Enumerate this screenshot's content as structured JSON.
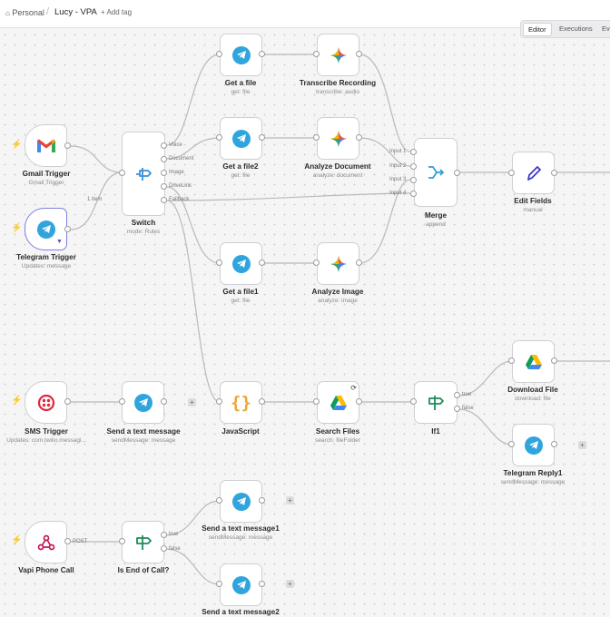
{
  "header": {
    "project": "Personal",
    "workflow_name": "Lucy - VPA",
    "add_tag": "+ Add tag",
    "tabs": [
      "Editor",
      "Executions",
      "Eva"
    ]
  },
  "colors": {
    "telegram": "#30a5dd",
    "gmail_red": "#ea4335",
    "twilio_red": "#e0263e",
    "switch_blue": "#3a8fd8",
    "if_green": "#1f8a5a",
    "edit_purple": "#3f37c9",
    "trigger_bolt": "#f07b5b",
    "selected_border": "#7b7fe0"
  },
  "nodes": {
    "gmail_trigger": {
      "title": "Gmail Trigger",
      "subtitle": "Gmail Trigger",
      "icon": "gmail-icon"
    },
    "telegram_trigger": {
      "title": "Telegram Trigger",
      "subtitle": "Updates: message",
      "icon": "telegram-icon"
    },
    "switch": {
      "title": "Switch",
      "subtitle": "mode: Rules",
      "icon": "switch-icon",
      "outputs": [
        "Voice",
        "Document",
        "Image",
        "DriveLink",
        "Fallback"
      ]
    },
    "get_file": {
      "title": "Get a file",
      "subtitle": "get: file"
    },
    "get_file2": {
      "title": "Get a file2",
      "subtitle": "get: file"
    },
    "get_file1": {
      "title": "Get a file1",
      "subtitle": "get: file"
    },
    "transcribe": {
      "title": "Transcribe Recording",
      "subtitle": "transcribe: audio"
    },
    "analyze_document": {
      "title": "Analyze Document",
      "subtitle": "analyze: document"
    },
    "analyze_image": {
      "title": "Analyze Image",
      "subtitle": "analyze: image"
    },
    "merge": {
      "title": "Merge",
      "subtitle": "append",
      "inputs": [
        "Input 1",
        "Input 2",
        "Input 3",
        "Input 4"
      ]
    },
    "edit_fields": {
      "title": "Edit Fields",
      "subtitle": "manual"
    },
    "sms_trigger": {
      "title": "SMS Trigger",
      "subtitle": "Updates: com.twilio.messagi..."
    },
    "send_text": {
      "title": "Send a text message",
      "subtitle": "sendMessage: message"
    },
    "javascript": {
      "title": "JavaScript",
      "subtitle": ""
    },
    "search_files": {
      "title": "Search Files",
      "subtitle": "search: fileFolder"
    },
    "if1": {
      "title": "If1",
      "subtitle": "",
      "outputs": [
        "true",
        "false"
      ]
    },
    "download_file": {
      "title": "Download File",
      "subtitle": "download: file"
    },
    "telegram_reply1": {
      "title": "Telegram Reply1",
      "subtitle": "sendMessage: message"
    },
    "vapi_call": {
      "title": "Vapi Phone Call",
      "subtitle": "",
      "output_label": "POST"
    },
    "is_end_call": {
      "title": "Is End of Call?",
      "subtitle": "",
      "outputs": [
        "true",
        "false"
      ]
    },
    "send_text1": {
      "title": "Send a text message1",
      "subtitle": "sendMessage: message"
    },
    "send_text2": {
      "title": "Send a text message2",
      "subtitle": ""
    }
  },
  "edge_labels": {
    "one_item": "1 item"
  },
  "plus_symbol": "+"
}
